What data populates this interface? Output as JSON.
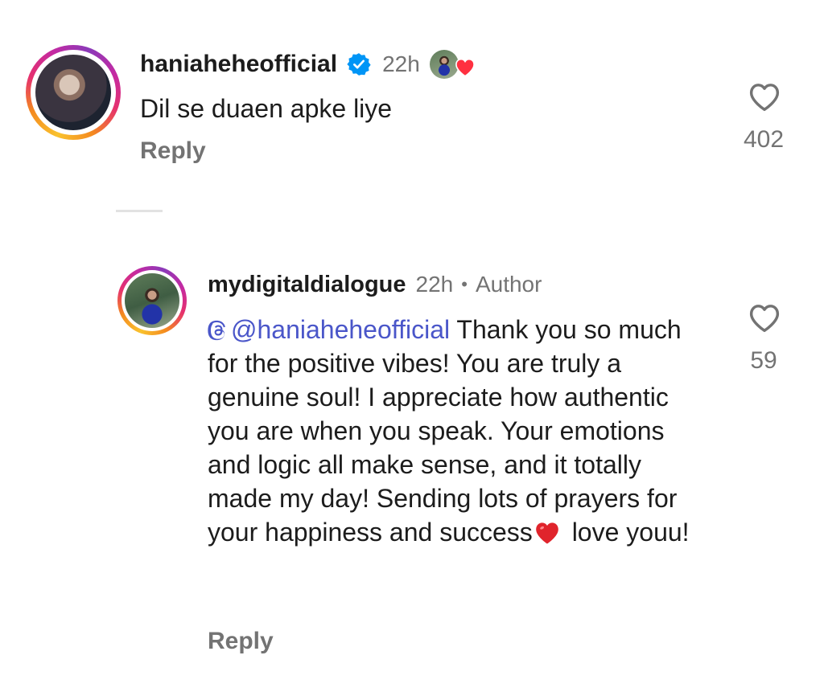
{
  "comment": {
    "username": "haniaheheofficial",
    "time": "22h",
    "text": "Dil se duaen apke liye",
    "reply_label": "Reply",
    "like_count": "402"
  },
  "reply": {
    "username": "mydigitaldialogue",
    "time": "22h",
    "separator": "•",
    "author_tag": "Author",
    "mention": "@haniaheheofficial",
    "text_part1": " Thank you so much for the positive vibes! You are truly a genuine soul! I appreciate how authentic you are when you speak. Your emotions and logic all make sense, and it totally made my day! Sending lots of prayers for your happiness and success",
    "text_part2": " love youu!",
    "reply_label": "Reply",
    "like_count": "59"
  },
  "icons": {
    "verified": "verified-badge-icon",
    "like": "heart-outline-icon",
    "liked_by_author": "heart-filled-icon",
    "threads_mention": "threads-icon"
  },
  "colors": {
    "verified_blue": "#0095f6",
    "heart_red": "#ff3040",
    "mention_blue": "#4a56c9",
    "secondary_text": "#737373"
  }
}
